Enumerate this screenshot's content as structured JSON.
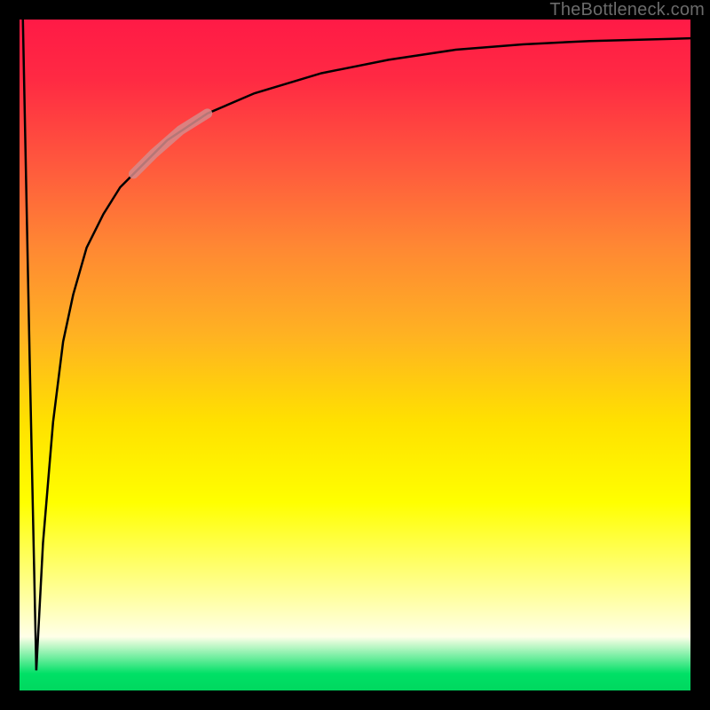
{
  "watermark": "TheBottleneck.com",
  "chart_data": {
    "type": "line",
    "title": "",
    "xlabel": "",
    "ylabel": "",
    "xlim": [
      0,
      100
    ],
    "ylim": [
      0,
      100
    ],
    "grid": false,
    "legend": false,
    "series": [
      {
        "name": "black-curve",
        "color": "#000000",
        "x": [
          0.5,
          1.5,
          2.5,
          3.5,
          5,
          6.5,
          8,
          10,
          12.5,
          15,
          18,
          22,
          28,
          35,
          45,
          55,
          65,
          75,
          85,
          100
        ],
        "values": [
          100,
          50,
          3,
          22,
          40,
          52,
          59,
          66,
          71,
          75,
          78,
          82,
          86,
          89,
          92,
          94,
          95.5,
          96.3,
          96.8,
          97.2
        ]
      },
      {
        "name": "pink-highlight",
        "color": "#d68b8b",
        "x": [
          17,
          20,
          24,
          28
        ],
        "values": [
          77,
          80,
          83.5,
          86
        ]
      }
    ],
    "gradient_stops": [
      {
        "pos": 0.0,
        "color": "#ff1a46"
      },
      {
        "pos": 0.6,
        "color": "#ffe100"
      },
      {
        "pos": 0.72,
        "color": "#ffff00"
      },
      {
        "pos": 0.97,
        "color": "#00e066"
      },
      {
        "pos": 1.0,
        "color": "#00d85f"
      }
    ]
  }
}
